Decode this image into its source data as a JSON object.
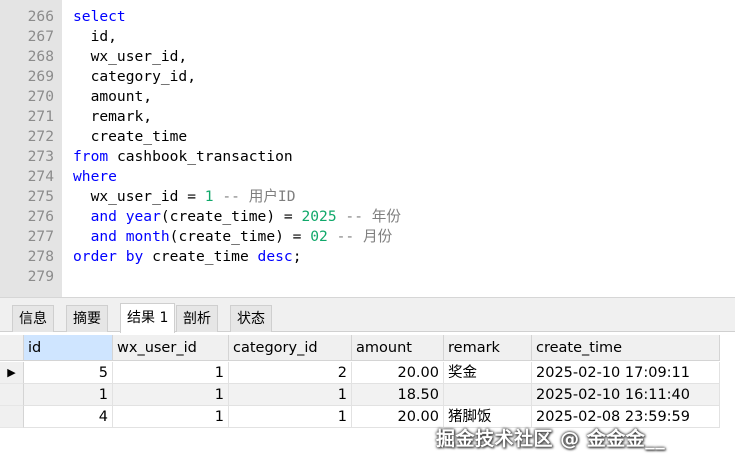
{
  "editor": {
    "lines": [
      {
        "n": "266",
        "t": [
          [
            "kw",
            "select"
          ]
        ]
      },
      {
        "n": "267",
        "t": [
          [
            "",
            "  id,"
          ]
        ]
      },
      {
        "n": "268",
        "t": [
          [
            "",
            "  wx_user_id,"
          ]
        ]
      },
      {
        "n": "269",
        "t": [
          [
            "",
            "  category_id,"
          ]
        ]
      },
      {
        "n": "270",
        "t": [
          [
            "",
            "  amount,"
          ]
        ]
      },
      {
        "n": "271",
        "t": [
          [
            "",
            "  remark,"
          ]
        ]
      },
      {
        "n": "272",
        "t": [
          [
            "",
            "  create_time"
          ]
        ]
      },
      {
        "n": "273",
        "t": [
          [
            "kw",
            "from"
          ],
          [
            "",
            " cashbook_transaction"
          ]
        ]
      },
      {
        "n": "274",
        "t": [
          [
            "kw",
            "where"
          ]
        ]
      },
      {
        "n": "275",
        "t": [
          [
            "",
            "  wx_user_id = "
          ],
          [
            "num",
            "1"
          ],
          [
            "cm",
            " -- 用户ID"
          ]
        ]
      },
      {
        "n": "276",
        "t": [
          [
            "",
            "  "
          ],
          [
            "kw",
            "and"
          ],
          [
            "",
            " "
          ],
          [
            "fn",
            "year"
          ],
          [
            "",
            "(create_time) = "
          ],
          [
            "num",
            "2025"
          ],
          [
            "cm",
            " -- 年份"
          ]
        ]
      },
      {
        "n": "277",
        "t": [
          [
            "",
            "  "
          ],
          [
            "kw",
            "and"
          ],
          [
            "",
            " "
          ],
          [
            "fn",
            "month"
          ],
          [
            "",
            "(create_time) = "
          ],
          [
            "num",
            "02"
          ],
          [
            "cm",
            " -- 月份"
          ]
        ]
      },
      {
        "n": "278",
        "t": [
          [
            "kw",
            "order by"
          ],
          [
            "",
            " create_time "
          ],
          [
            "kw",
            "desc"
          ],
          [
            "",
            ";"
          ]
        ]
      },
      {
        "n": "279",
        "t": [
          [
            "",
            ""
          ]
        ]
      }
    ]
  },
  "tabs": [
    "信息",
    "摘要",
    "结果 1",
    "剖析",
    "状态"
  ],
  "active_tab": "结果 1",
  "grid": {
    "columns": [
      "id",
      "wx_user_id",
      "category_id",
      "amount",
      "remark",
      "create_time"
    ],
    "rows": [
      [
        "5",
        "1",
        "2",
        "20.00",
        "奖金",
        "2025-02-10 17:09:11"
      ],
      [
        "1",
        "1",
        "1",
        "18.50",
        "",
        "2025-02-10 16:11:40"
      ],
      [
        "4",
        "1",
        "1",
        "20.00",
        "猪脚饭",
        "2025-02-08 23:59:59"
      ]
    ],
    "current_row_marker": "▶"
  },
  "watermark": "掘金技术社区 @ 金金金__",
  "colors": {
    "keyword": "#0000ff",
    "number": "#10a86a",
    "comment": "#7f7f7f"
  }
}
